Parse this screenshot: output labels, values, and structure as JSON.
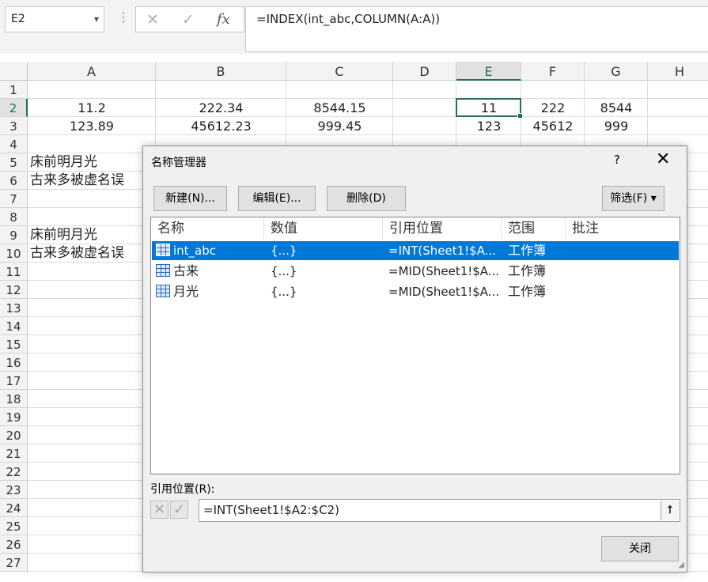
{
  "formula_bar": {
    "name_box": "E2",
    "cancel_icon": "✕",
    "enter_icon": "✓",
    "fx_label": "fx",
    "formula": "=INDEX(int_abc,COLUMN(A:A))"
  },
  "grid": {
    "columns": [
      "A",
      "B",
      "C",
      "D",
      "E",
      "F",
      "G",
      "H"
    ],
    "rows": [
      "1",
      "2",
      "3",
      "4",
      "5",
      "6",
      "7",
      "8",
      "9",
      "10",
      "11",
      "12",
      "13",
      "14",
      "15",
      "16",
      "17",
      "18",
      "19",
      "20",
      "21",
      "22",
      "23",
      "24",
      "25",
      "26",
      "27"
    ],
    "cells": {
      "A2": "11.2",
      "B2": "222.34",
      "C2": "8544.15",
      "E2": "11",
      "F2": "222",
      "G2": "8544",
      "A3": "123.89",
      "B3": "45612.23",
      "C3": "999.45",
      "E3": "123",
      "F3": "45612",
      "G3": "999",
      "A5": "床前明月光",
      "A6": "古来多被虚名误",
      "A9": "床前明月光",
      "A10": "古来多被虚名误"
    },
    "selected_cell": "E2"
  },
  "dialog": {
    "title": "名称管理器",
    "help": "?",
    "close": "✕",
    "buttons": {
      "new": "新建(N)...",
      "edit": "编辑(E)...",
      "delete": "删除(D)",
      "filter": "筛选(F)",
      "filter_caret": "▾"
    },
    "columns": [
      "名称",
      "数值",
      "引用位置",
      "范围",
      "批注"
    ],
    "names": [
      {
        "name": "int_abc",
        "value": "{...}",
        "refers_to": "=INT(Sheet1!$A...",
        "scope": "工作簿",
        "comment": "",
        "selected": true
      },
      {
        "name": "古来",
        "value": "{...}",
        "refers_to": "=MID(Sheet1!$A...",
        "scope": "工作簿",
        "comment": "",
        "selected": false
      },
      {
        "name": "月光",
        "value": "{...}",
        "refers_to": "=MID(Sheet1!$A...",
        "scope": "工作簿",
        "comment": "",
        "selected": false
      }
    ],
    "ref_label": "引用位置(R):",
    "ref_value": "=INT(Sheet1!$A2:$C2)",
    "ref_cancel": "✕",
    "ref_ok": "✓",
    "ref_collapse": "⭡",
    "close_button": "关闭"
  }
}
